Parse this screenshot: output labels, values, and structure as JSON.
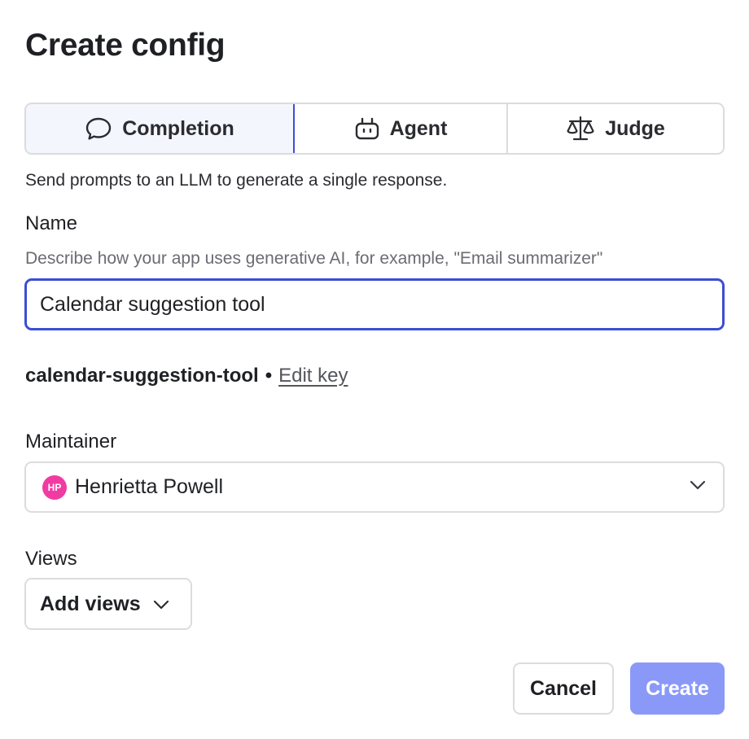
{
  "dialog": {
    "title": "Create config",
    "types": {
      "completion": {
        "label": "Completion",
        "icon": "chat-bubble-icon",
        "selected": true
      },
      "agent": {
        "label": "Agent",
        "icon": "robot-icon",
        "selected": false
      },
      "judge": {
        "label": "Judge",
        "icon": "scale-icon",
        "selected": false
      }
    },
    "type_description": "Send prompts to an LLM to generate a single response.",
    "name": {
      "label": "Name",
      "hint": "Describe how your app uses generative AI, for example, \"Email summarizer\"",
      "value": "Calendar suggestion tool"
    },
    "key": {
      "value": "calendar-suggestion-tool",
      "separator": "•",
      "edit_label": "Edit key"
    },
    "maintainer": {
      "label": "Maintainer",
      "avatar_initials": "HP",
      "avatar_color": "#f13ba2",
      "value": "Henrietta Powell"
    },
    "views": {
      "label": "Views",
      "button_label": "Add views"
    },
    "actions": {
      "cancel_label": "Cancel",
      "create_label": "Create",
      "create_color": "#8a99f8"
    },
    "colors": {
      "accent": "#3d4fd8",
      "border": "#dcdcdf"
    }
  }
}
